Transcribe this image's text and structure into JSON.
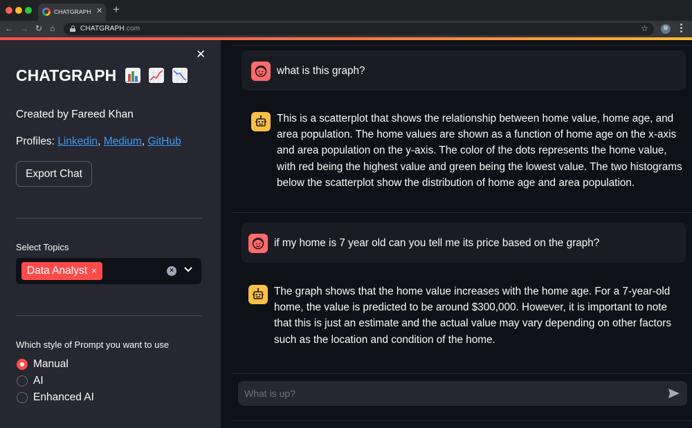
{
  "browser": {
    "tab_title": "CHATGRAPH",
    "tab_close": "✕",
    "new_tab": "+",
    "url_host": "CHATGRAPH",
    "url_tld": ".com",
    "nav": {
      "back": "←",
      "forward": "→",
      "reload": "↻",
      "home": "⌂"
    },
    "star": "☆"
  },
  "sidebar": {
    "close": "✕",
    "title": "CHATGRAPH",
    "title_emojis": [
      "bar-chart-icon",
      "chart-increasing-icon",
      "chart-decreasing-icon"
    ],
    "created_by": "Created by Fareed Khan",
    "profiles_label": "Profiles: ",
    "profile_links": [
      "Linkedin",
      "Medium",
      "GitHub"
    ],
    "link_sep": ", ",
    "export_button": "Export Chat",
    "topics_label": "Select Topics",
    "selected_topics": [
      "Data Analyst"
    ],
    "chip_remove": "×",
    "clear_all": "×",
    "dropdown": "⌄",
    "prompt_style_label": "Which style of Prompt you want to use",
    "prompt_styles": [
      {
        "label": "Manual",
        "selected": true
      },
      {
        "label": "AI",
        "selected": false
      },
      {
        "label": "Enhanced AI",
        "selected": false
      }
    ]
  },
  "chat": {
    "messages": [
      {
        "role": "user",
        "text": "what is this graph?"
      },
      {
        "role": "assistant",
        "text": "This is a scatterplot that shows the relationship between home value, home age, and area population. The home values are shown as a function of home age on the x-axis and area population on the y-axis. The color of the dots represents the home value, with red being the highest value and green being the lowest value. The two histograms below the scatterplot show the distribution of home age and area population."
      },
      {
        "role": "user",
        "text": "if my home is 7 year old can you tell me its price based on the graph?"
      },
      {
        "role": "assistant",
        "text": "The graph shows that the home value increases with the home age. For a 7-year-old home, the value is predicted to be around $300,000. However, it is important to note that this is just an estimate and the actual value may vary depending on other factors such as the location and condition of the home."
      }
    ],
    "input_placeholder": "What is up?",
    "input_value": ""
  },
  "colors": {
    "accent": "#ff4b4b",
    "sidebar_bg": "#262730",
    "main_bg": "#0e1117",
    "link": "#3d9df3",
    "user_avatar": "#ff6b6b",
    "bot_avatar": "#fbbf45"
  }
}
